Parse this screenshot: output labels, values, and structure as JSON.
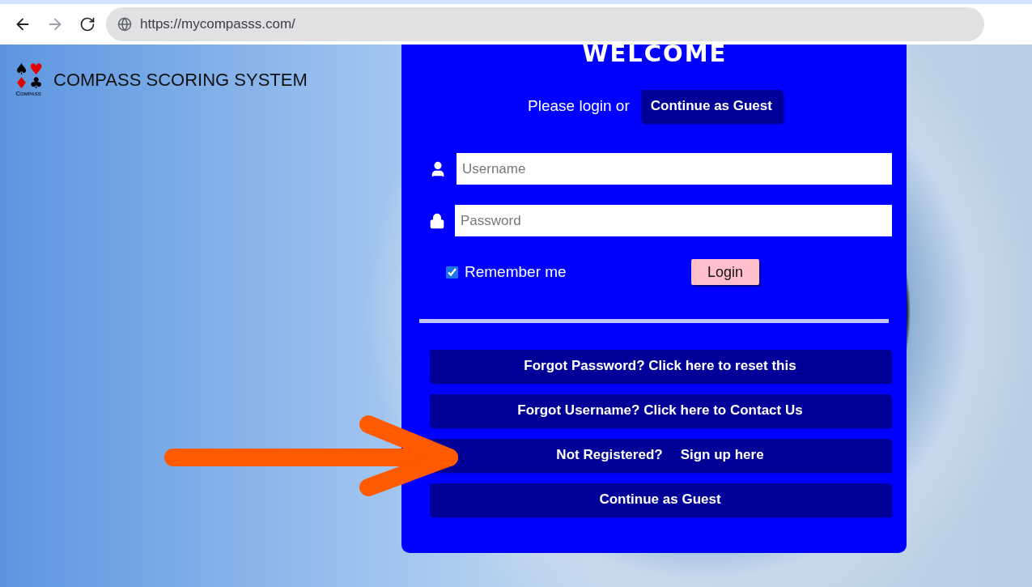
{
  "browser": {
    "back_disabled": false,
    "forward_disabled": true,
    "url": "https://mycompasss.com/"
  },
  "logo": {
    "suits": [
      {
        "symbol": "♠",
        "color": "#000000"
      },
      {
        "symbol": "♥",
        "color": "#e00000"
      },
      {
        "symbol": "♦",
        "color": "#e00000"
      },
      {
        "symbol": "♣",
        "color": "#000000"
      }
    ],
    "caption": "Compass"
  },
  "site_title": "COMPASS SCORING SYSTEM",
  "panel": {
    "title": "WELCOME",
    "prompt": "Please login or",
    "guest_button": "Continue as Guest",
    "username": {
      "placeholder": "Username"
    },
    "password": {
      "placeholder": "Password"
    },
    "remember": {
      "label": "Remember me",
      "checked": true
    },
    "login_button": "Login",
    "links": [
      {
        "parts": [
          "Forgot Password? Click here to reset this"
        ]
      },
      {
        "parts": [
          "Forgot Username? Click here to Contact Us"
        ]
      },
      {
        "parts": [
          "Not Registered?",
          "Sign up here"
        ]
      },
      {
        "parts": [
          "Continue as Guest"
        ]
      }
    ]
  },
  "annotation": {
    "kind": "arrow"
  }
}
